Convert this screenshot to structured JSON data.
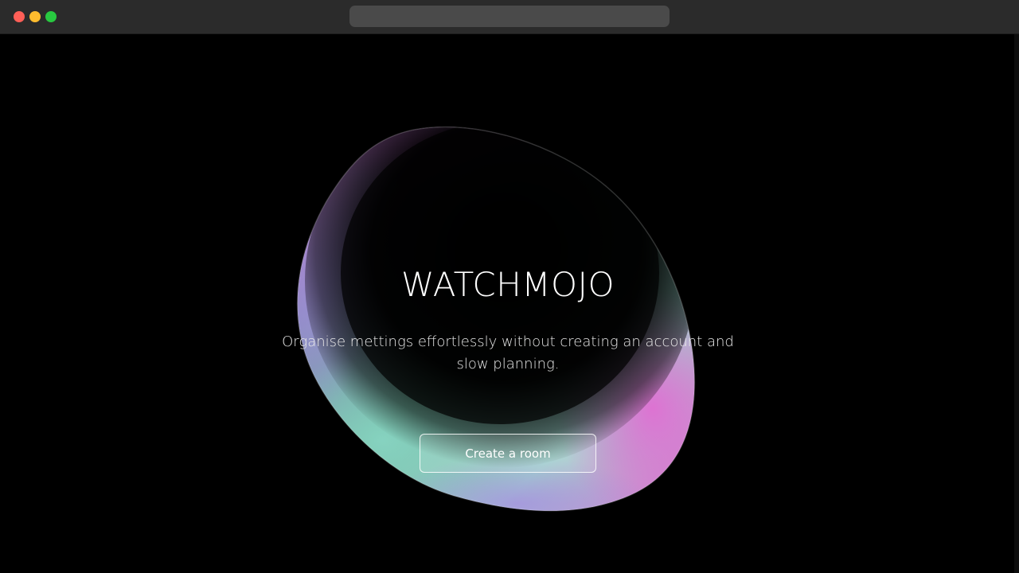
{
  "window": {
    "controls": [
      "close",
      "minimize",
      "zoom"
    ],
    "address_bar_value": "",
    "colors": {
      "close": "#ff5f57",
      "minimize": "#febc2e",
      "zoom": "#28c840",
      "titlebar": "#2b2b2b"
    }
  },
  "hero": {
    "title": "WATCHMOJO",
    "subtitle": "Organise mettings effortlessly without creating an account and slow planning.",
    "cta_label": "Create a room"
  },
  "theme": {
    "background": "#000000",
    "accent_pink": "#d85fc9",
    "accent_teal": "#7fd6c0",
    "accent_violet": "#9b7bd8"
  }
}
